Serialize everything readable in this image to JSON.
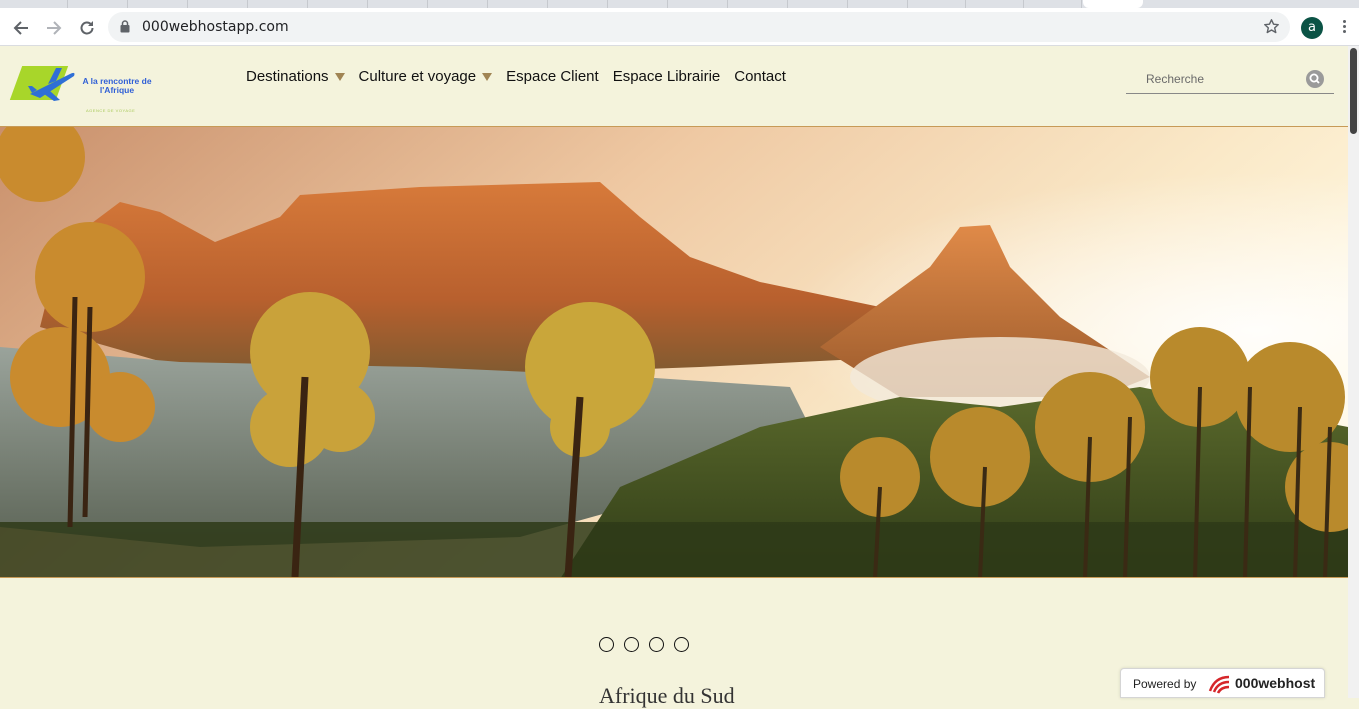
{
  "browser": {
    "url": "000webhostapp.com",
    "profile_initial": "a"
  },
  "site": {
    "logo_title": "A la rencontre de l'Afrique",
    "logo_subtitle": "AGENCE DE VOYAGE",
    "nav": [
      {
        "label": "Destinations",
        "has_dropdown": true
      },
      {
        "label": "Culture et voyage",
        "has_dropdown": true
      },
      {
        "label": "Espace Client",
        "has_dropdown": false
      },
      {
        "label": "Espace Librairie",
        "has_dropdown": false
      },
      {
        "label": "Contact",
        "has_dropdown": false
      }
    ],
    "search_placeholder": "Recherche"
  },
  "carousel": {
    "dots": 4,
    "caption": "Afrique du Sud"
  },
  "footer_badge": {
    "label": "Powered by",
    "brand": "000webhost"
  },
  "colors": {
    "page_bg": "#f4f3dc",
    "caret": "#a08453"
  }
}
